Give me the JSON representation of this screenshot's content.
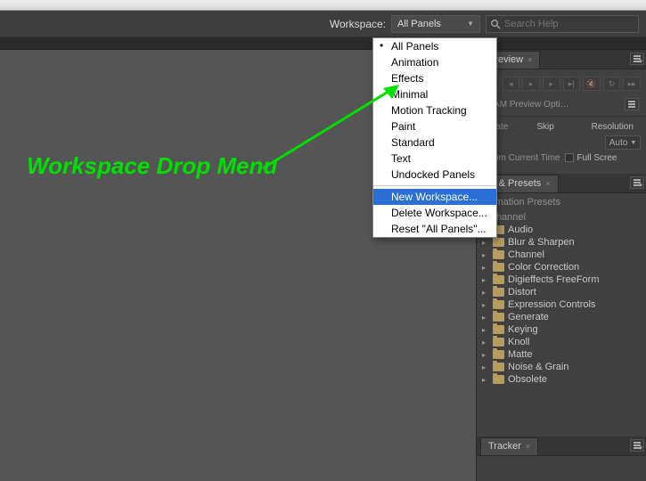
{
  "topbar": {
    "workspace_label": "Workspace:",
    "workspace_selected": "All Panels",
    "search_placeholder": "Search Help"
  },
  "dropdown": {
    "items": [
      {
        "label": "All Panels",
        "checked": true
      },
      {
        "label": "Animation"
      },
      {
        "label": "Effects"
      },
      {
        "label": "Minimal"
      },
      {
        "label": "Motion Tracking"
      },
      {
        "label": "Paint"
      },
      {
        "label": "Standard"
      },
      {
        "label": "Text"
      },
      {
        "label": "Undocked Panels"
      }
    ],
    "actions": [
      {
        "label": "New Workspace...",
        "highlight": true
      },
      {
        "label": "Delete Workspace..."
      },
      {
        "label": "Reset \"All Panels\"..."
      }
    ]
  },
  "preview": {
    "tab": "Preview",
    "ram_option": "+RAM Preview Opti…",
    "labels": {
      "rate": "e Rate",
      "skip": "Skip",
      "resolution": "Resolution",
      "auto": "Auto",
      "from_current": "om Current Time",
      "full_screen": "Full Scree"
    }
  },
  "presets": {
    "tab": "ts & Presets",
    "header": "nimation Presets",
    "channel_partial": "Channel",
    "items": [
      "Audio",
      "Blur & Sharpen",
      "Channel",
      "Color Correction",
      "Digieffects FreeForm",
      "Distort",
      "Expression Controls",
      "Generate",
      "Keying",
      "Knoll",
      "Matte",
      "Noise & Grain",
      "Obsolete"
    ]
  },
  "tracker": {
    "tab": "Tracker"
  },
  "annotation": {
    "text": "Workspace Drop Menu"
  }
}
